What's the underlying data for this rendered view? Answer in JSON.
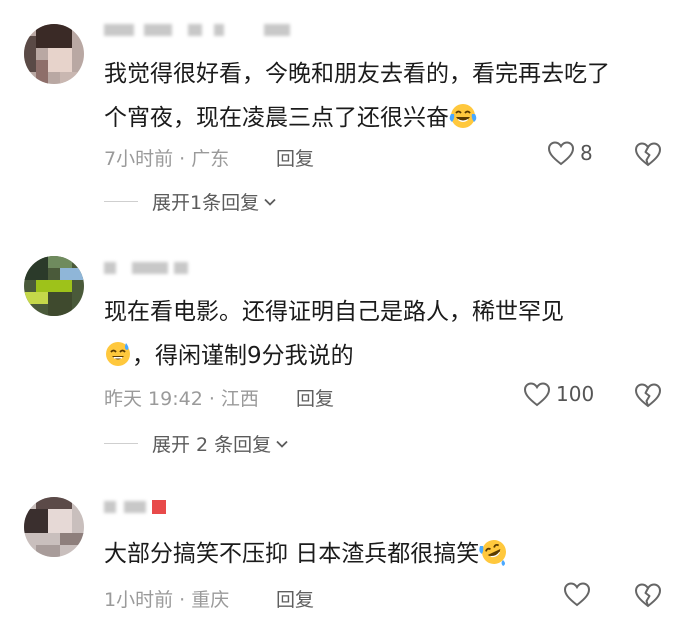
{
  "comments": [
    {
      "text_line1": "我觉得很好看，今晚和朋友去看的，看完再去吃了",
      "text_line2": "个宵夜，现在凌晨三点了还很兴奋",
      "emoji": "crying-laughing-emoji",
      "time_location": "7小时前 · 广东",
      "reply_label": "回复",
      "like_count": "8",
      "expand_label": "展开1条回复"
    },
    {
      "text_line1": "现在看电影。还得证明自己是路人，稀世罕见",
      "text_line2": "，得闲谨制9分我说的",
      "emoji": "sweat-smile-emoji",
      "time_location": "昨天 19:42 · 江西",
      "reply_label": "回复",
      "like_count": "100",
      "expand_label": "展开 2 条回复"
    },
    {
      "text_line1": "大部分搞笑不压抑 日本渣兵都很搞笑",
      "emoji": "rolling-laughing-emoji",
      "time_location": "1小时前 · 重庆",
      "reply_label": "回复",
      "like_count": ""
    }
  ],
  "icons": {
    "like": "heart-outline-icon",
    "dislike": "broken-heart-icon",
    "expand": "chevron-down-icon"
  },
  "colors": {
    "text": "#1b1b1b",
    "meta": "#9a9a9a",
    "icon": "#666666",
    "emoji_face": "#ffc83d",
    "emoji_tear": "#4aa8ff",
    "badge_red": "#e84a4a"
  }
}
